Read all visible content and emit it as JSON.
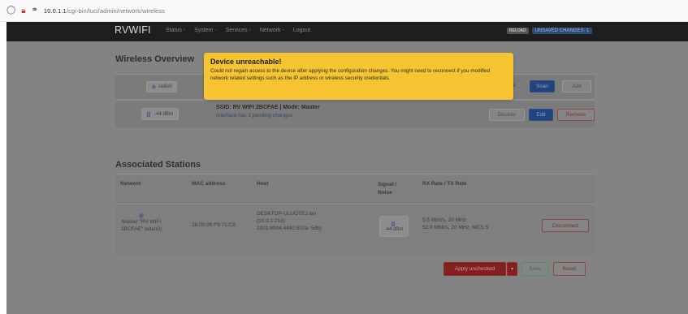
{
  "browser": {
    "url_host": "10.0.1.1",
    "url_path": "/cgi-bin/luci/admin/network/wireless"
  },
  "navbar": {
    "brand": "RVWIFI",
    "menu": [
      "Status -",
      "System -",
      "Services -",
      "Network -",
      "Logout"
    ],
    "status_badge": "RELOAD",
    "changes_badge": "UNSAVED CHANGES: 1"
  },
  "overview": {
    "title": "Wireless Overview",
    "radio": {
      "label": "radio0",
      "trailing_text": "e",
      "scan": "Scan",
      "add": "Add"
    },
    "iface": {
      "signal": "-44 dBm",
      "ssid_line": "SSID: RV WIFI 2BCFAE | Mode: Master",
      "pending": "Interface has 1 pending changes",
      "disable": "Disable",
      "edit": "Edit",
      "remove": "Remove"
    }
  },
  "modal": {
    "title": "Device unreachable!",
    "body": "Could not regain access to the device after applying the configuration changes. You might need to reconnect if you modified network related settings such as the IP address or wireless security credentials."
  },
  "stations": {
    "title": "Associated Stations",
    "headers": [
      "Network",
      "MAC address",
      "Host",
      "Signal / Noise",
      "RX Rate / TX Rate"
    ],
    "row": {
      "network": [
        "Master \"RV WIFI",
        "2BCFAE\" (wlan0)"
      ],
      "mac": "28:00:06:F9:71:C8",
      "host": [
        "DESKTOP-ULUOTEJ.lan",
        "(10.0.1.218)",
        "2001:8004:4480:502a::5db)"
      ],
      "signal": "-44 dBm",
      "rates": [
        "5.5 Mbit/s, 20 MHz",
        "52.0 Mbit/s, 20 MHz, MCS 5"
      ],
      "disconnect": "Disconnect"
    }
  },
  "footer": {
    "apply": "Apply unchecked",
    "save": "Save",
    "reset": "Reset"
  }
}
